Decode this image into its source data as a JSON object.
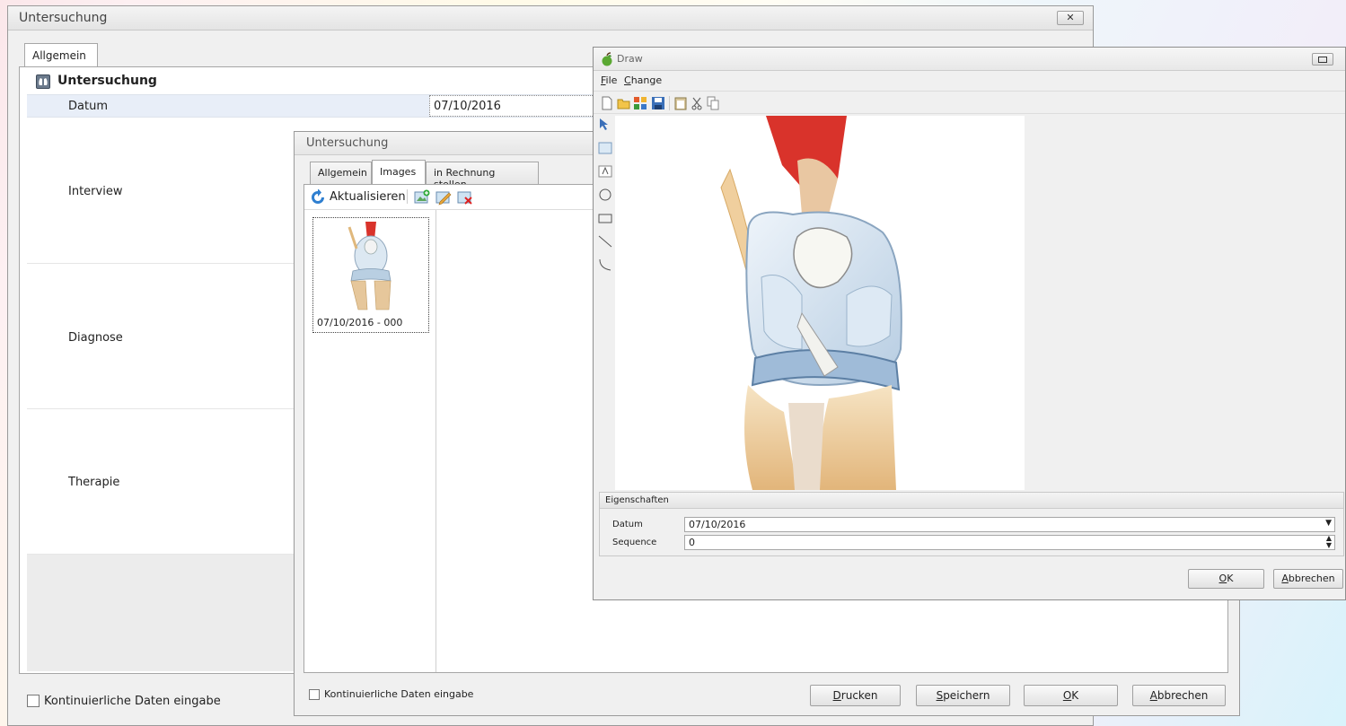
{
  "main_window": {
    "title": "Untersuchung",
    "close_label": "✕",
    "tab_allgemein": "Allgemein",
    "section_title": "Untersuchung",
    "datum_label": "Datum",
    "datum_value": "07/10/2016",
    "rows": [
      "Interview",
      "Diagnose",
      "Therapie"
    ],
    "checkbox_label": "Kontinuierliche Daten eingabe"
  },
  "images_window": {
    "title": "Untersuchung",
    "tabs": [
      "Allgemein",
      "Images",
      "in Rechnung stellen"
    ],
    "refresh_label": "Aktualisieren",
    "thumbnail_caption": "07/10/2016 - 000",
    "checkbox_label": "Kontinuierliche Daten eingabe",
    "buttons": {
      "print": {
        "key": "D",
        "rest": "rucken"
      },
      "save": {
        "key": "S",
        "rest": "peichern"
      },
      "ok": {
        "key": "O",
        "rest": "K"
      },
      "cancel": {
        "key": "A",
        "rest": "bbrechen"
      }
    }
  },
  "draw_window": {
    "title": "Draw",
    "menu": {
      "file": {
        "key": "F",
        "rest": "ile"
      },
      "change": {
        "key": "C",
        "rest": "hange"
      }
    },
    "properties_title": "Eigenschaften",
    "datum_label": "Datum",
    "datum_value": "07/10/2016",
    "sequence_label": "Sequence",
    "sequence_value": "0",
    "ok": {
      "key": "O",
      "rest": "K"
    },
    "cancel": {
      "key": "A",
      "rest": "bbrechen"
    }
  },
  "colors": {
    "accent_red": "#d9332b",
    "selection_row": "#e8eef8",
    "window_bg": "#f0f0f0"
  }
}
